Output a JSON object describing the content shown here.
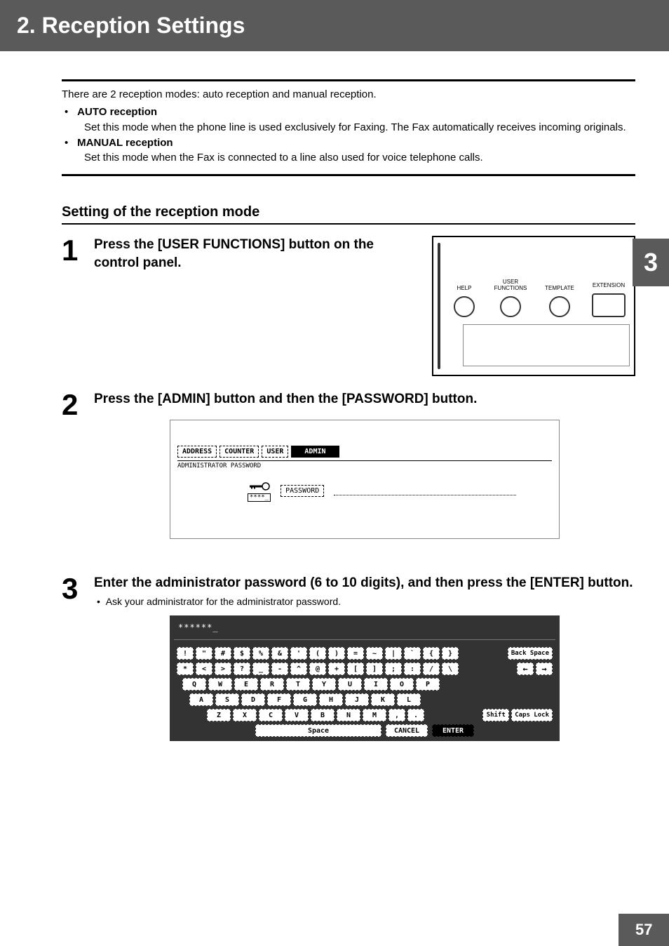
{
  "header": {
    "title": "2. Reception Settings"
  },
  "intro": "There are 2 reception modes: auto reception and manual reception.",
  "modes": {
    "auto": {
      "title": "AUTO reception",
      "desc": "Set this mode when the phone line is used exclusively for Faxing. The Fax automatically receives incoming originals."
    },
    "manual": {
      "title": "MANUAL reception",
      "desc": "Set this mode when the Fax is connected to a line also used for voice telephone calls."
    }
  },
  "section": {
    "heading": "Setting of the reception mode"
  },
  "chapter": "3",
  "steps": {
    "s1": {
      "num": "1",
      "text": "Press the [USER FUNCTIONS] button on the control panel."
    },
    "s2": {
      "num": "2",
      "text": "Press the [ADMIN] button and then the [PASSWORD] button."
    },
    "s3": {
      "num": "3",
      "text": "Enter the administrator password (6 to 10 digits), and then press the [ENTER] button.",
      "note": "Ask your administrator for the administrator password."
    }
  },
  "control_panel": {
    "help": "HELP",
    "user_functions": "USER FUNCTIONS",
    "template": "TEMPLATE",
    "extension": "EXTENSION"
  },
  "admin_screen": {
    "tabs": {
      "address": "ADDRESS",
      "counter": "COUNTER",
      "user": "USER",
      "admin": "ADMIN"
    },
    "subtitle": "ADMINISTRATOR PASSWORD",
    "password_btn": "PASSWORD",
    "asterisk_box": "****_"
  },
  "keyboard": {
    "display": "******_",
    "row1": [
      "!",
      "\"",
      "#",
      "$",
      "%",
      "&",
      "'",
      "(",
      ")",
      "=",
      "~",
      "|",
      "`",
      "{",
      "}"
    ],
    "backspace": "Back Space",
    "row2": [
      "*",
      "<",
      ">",
      "?",
      "_",
      "-",
      "^",
      "@",
      "+",
      "[",
      "]",
      ";",
      ":",
      "/",
      "\\"
    ],
    "arrow_left": "←",
    "arrow_right": "→",
    "row3": [
      "Q",
      "W",
      "E",
      "R",
      "T",
      "Y",
      "U",
      "I",
      "O",
      "P"
    ],
    "row4": [
      "A",
      "S",
      "D",
      "F",
      "G",
      "H",
      "J",
      "K",
      "L"
    ],
    "row5": [
      "Z",
      "X",
      "C",
      "V",
      "B",
      "N",
      "M",
      ",",
      "."
    ],
    "shift": "Shift",
    "caps": "Caps Lock",
    "space": "Space",
    "cancel": "CANCEL",
    "enter": "ENTER"
  },
  "page_number": "57"
}
